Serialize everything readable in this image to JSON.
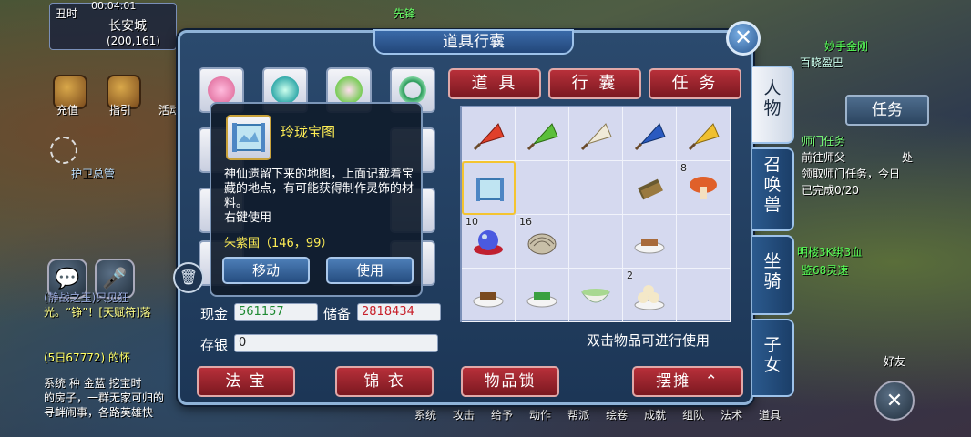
{
  "hud": {
    "time": "丑时",
    "clock": "00:04:01",
    "location": "长安城",
    "coords": "(200,161)",
    "top_center_text": "先锋",
    "recharge": "充值",
    "guide": "指引",
    "activity": "活动",
    "guard": "护卫总管",
    "right_task_tab": "任务",
    "task_title": "师门任务",
    "task_lines": [
      "前往师父",
      "处",
      "领取师门任务，今日",
      "已完成0/20"
    ],
    "names": [
      "百晓盈巴",
      "妙手金刚",
      "明楼3K绑3血",
      "鉴68灵速"
    ],
    "friend": "好友",
    "bottom_menu": [
      "系统",
      "攻击",
      "给予",
      "动作",
      "帮派",
      "绘卷",
      "成就",
      "组队",
      "法术",
      "道具"
    ],
    "chat_lines": [
      "系统",
      "(静战之玉)只见狂",
      "光。“铮”！[天赋符]落",
      "(5日67772) 的怀",
      "系统  种   金蓝  挖宝时",
      "的房子，一群无家可归的",
      "寻衅闹事，各路英雄快"
    ]
  },
  "panel": {
    "title": "道具行囊",
    "close_label": "✕",
    "tabs": [
      "道 具",
      "行 囊",
      "任 务"
    ],
    "side_tabs": [
      "人物",
      "召唤兽",
      "坐骑",
      "子女"
    ],
    "money_label": "现金",
    "money_value": "561157",
    "reserve_label": "储备",
    "reserve_value": "2818434",
    "deposit_label": "存银",
    "deposit_value": "0",
    "hint": "双击物品可进行使用",
    "bottom_buttons": [
      "法 宝",
      "锦 衣",
      "物品锁",
      "摆摊"
    ],
    "trash_icon": "🗑",
    "expand_icon": "⌃"
  },
  "tooltip": {
    "name": "玲珑宝图",
    "desc": "神仙遗留下来的地图，上面记载着宝藏的地点，有可能获得制作灵饰的材料。",
    "usage": "右键使用",
    "location": "朱紫国（146，99）",
    "btn_move": "移动",
    "btn_use": "使用"
  },
  "bag": {
    "cells": [
      {
        "kind": "flag-red",
        "count": ""
      },
      {
        "kind": "flag-green",
        "count": ""
      },
      {
        "kind": "flag-white",
        "count": ""
      },
      {
        "kind": "flag-blue",
        "count": ""
      },
      {
        "kind": "flag-yellow",
        "count": ""
      },
      {
        "kind": "treasure-map",
        "count": "",
        "selected": true
      },
      {
        "kind": "empty",
        "count": ""
      },
      {
        "kind": "empty",
        "count": ""
      },
      {
        "kind": "scroll-bundle",
        "count": ""
      },
      {
        "kind": "mushroom",
        "count": "8"
      },
      {
        "kind": "orb",
        "count": "10"
      },
      {
        "kind": "shell",
        "count": "16"
      },
      {
        "kind": "empty",
        "count": ""
      },
      {
        "kind": "dish-tofu",
        "count": ""
      },
      {
        "kind": "empty",
        "count": ""
      },
      {
        "kind": "dish-brown",
        "count": ""
      },
      {
        "kind": "dish-green",
        "count": ""
      },
      {
        "kind": "bowl",
        "count": ""
      },
      {
        "kind": "dumplings",
        "count": "2"
      },
      {
        "kind": "empty",
        "count": ""
      }
    ]
  },
  "equip": [
    "pink-flower",
    "jade-pendant",
    "lotus",
    "jade-ring",
    "empty-slot",
    "empty-slot",
    "empty-slot",
    "empty-slot",
    "empty-slot",
    "empty-slot",
    "empty-slot",
    "empty-slot"
  ],
  "colors": {
    "panel_bg": "#1c3656",
    "tab_red": "#b8303a",
    "money_green": "#2e9e3e",
    "money_red": "#c8202a",
    "tooltip_gold": "#ffee55"
  }
}
